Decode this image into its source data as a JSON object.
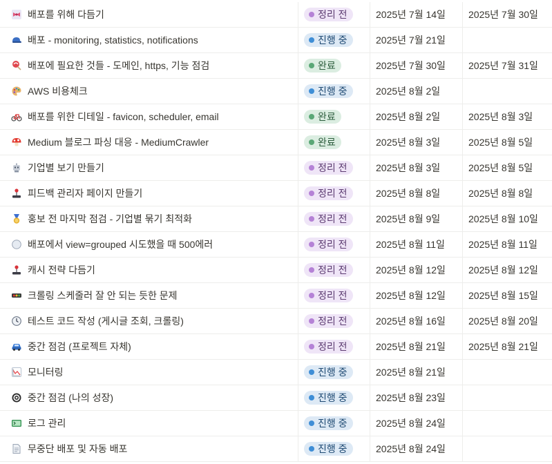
{
  "statuses": {
    "todo": {
      "label": "정리 전",
      "bg": "#efe5f7",
      "dot": "#b582d6",
      "text": "#5c3b71"
    },
    "doing": {
      "label": "진행 중",
      "bg": "#dde9f5",
      "dot": "#3f8ed6",
      "text": "#1f4a73"
    },
    "done": {
      "label": "완료",
      "bg": "#dbede1",
      "dot": "#5aa776",
      "text": "#2e5e3e"
    }
  },
  "rows": [
    {
      "icon": "bow-icon",
      "title": "배포를 위해 다듬기",
      "status": "todo",
      "status_label": "정리 전",
      "start": "2025년 7월 14일",
      "end": "2025년 7월 30일"
    },
    {
      "icon": "cap-icon",
      "title": "배포 - monitoring, statistics, notifications",
      "status": "doing",
      "status_label": "진행 중",
      "start": "2025년 7월 21일",
      "end": ""
    },
    {
      "icon": "lollipop-icon",
      "title": "배포에 필요한 것들 - 도메인, https, 기능 점검",
      "status": "done",
      "status_label": "완료",
      "start": "2025년 7월 30일",
      "end": "2025년 7월 31일"
    },
    {
      "icon": "palette-icon",
      "title": "AWS 비용체크",
      "status": "doing",
      "status_label": "진행 중",
      "start": "2025년 8월 2일",
      "end": ""
    },
    {
      "icon": "bicycle-icon",
      "title": "배포를 위한 디테일 - favicon, scheduler, email",
      "status": "done",
      "status_label": "완료",
      "start": "2025년 8월 2일",
      "end": "2025년 8월 3일"
    },
    {
      "icon": "mushroom-icon",
      "title": "Medium 블로그 파싱 대응 - MediumCrawler",
      "status": "done",
      "status_label": "완료",
      "start": "2025년 8월 3일",
      "end": "2025년 8월 5일"
    },
    {
      "icon": "robot-icon",
      "title": "기업별 보기 만들기",
      "status": "todo",
      "status_label": "정리 전",
      "start": "2025년 8월 3일",
      "end": "2025년 8월 5일"
    },
    {
      "icon": "joystick-icon",
      "title": "피드백 관리자 페이지 만들기",
      "status": "todo",
      "status_label": "정리 전",
      "start": "2025년 8월 8일",
      "end": "2025년 8월 8일"
    },
    {
      "icon": "medal-icon",
      "title": "홍보 전 마지막 점검 - 기업별 묶기 최적화",
      "status": "todo",
      "status_label": "정리 전",
      "start": "2025년 8월 9일",
      "end": "2025년 8월 10일"
    },
    {
      "icon": "circle-icon",
      "title": "배포에서 view=grouped 시도했을 때 500에러",
      "status": "todo",
      "status_label": "정리 전",
      "start": "2025년 8월 11일",
      "end": "2025년 8월 11일"
    },
    {
      "icon": "joystick-icon",
      "title": "캐시 전략 다듬기",
      "status": "todo",
      "status_label": "정리 전",
      "start": "2025년 8월 12일",
      "end": "2025년 8월 12일"
    },
    {
      "icon": "traffic-light-icon",
      "title": "크롤링 스케줄러 잘 안 되는 듯한 문제",
      "status": "todo",
      "status_label": "정리 전",
      "start": "2025년 8월 12일",
      "end": "2025년 8월 15일"
    },
    {
      "icon": "clock-icon",
      "title": "테스트 코드 작성 (게시글 조회, 크롤링)",
      "status": "todo",
      "status_label": "정리 전",
      "start": "2025년 8월 16일",
      "end": "2025년 8월 20일"
    },
    {
      "icon": "car-icon",
      "title": "중간 점검 (프로젝트 자체)",
      "status": "todo",
      "status_label": "정리 전",
      "start": "2025년 8월 21일",
      "end": "2025년 8월 21일"
    },
    {
      "icon": "chart-icon",
      "title": "모니터링",
      "status": "doing",
      "status_label": "진행 중",
      "start": "2025년 8월 21일",
      "end": ""
    },
    {
      "icon": "target-icon",
      "title": "중간 점검 (나의 성장)",
      "status": "doing",
      "status_label": "진행 중",
      "start": "2025년 8월 23일",
      "end": ""
    },
    {
      "icon": "terminal-icon",
      "title": "로그 관리",
      "status": "doing",
      "status_label": "진행 중",
      "start": "2025년 8월 24일",
      "end": ""
    },
    {
      "icon": "document-icon",
      "title": "무중단 배포 및 자동 배포",
      "status": "doing",
      "status_label": "진행 중",
      "start": "2025년 8월 24일",
      "end": ""
    }
  ]
}
